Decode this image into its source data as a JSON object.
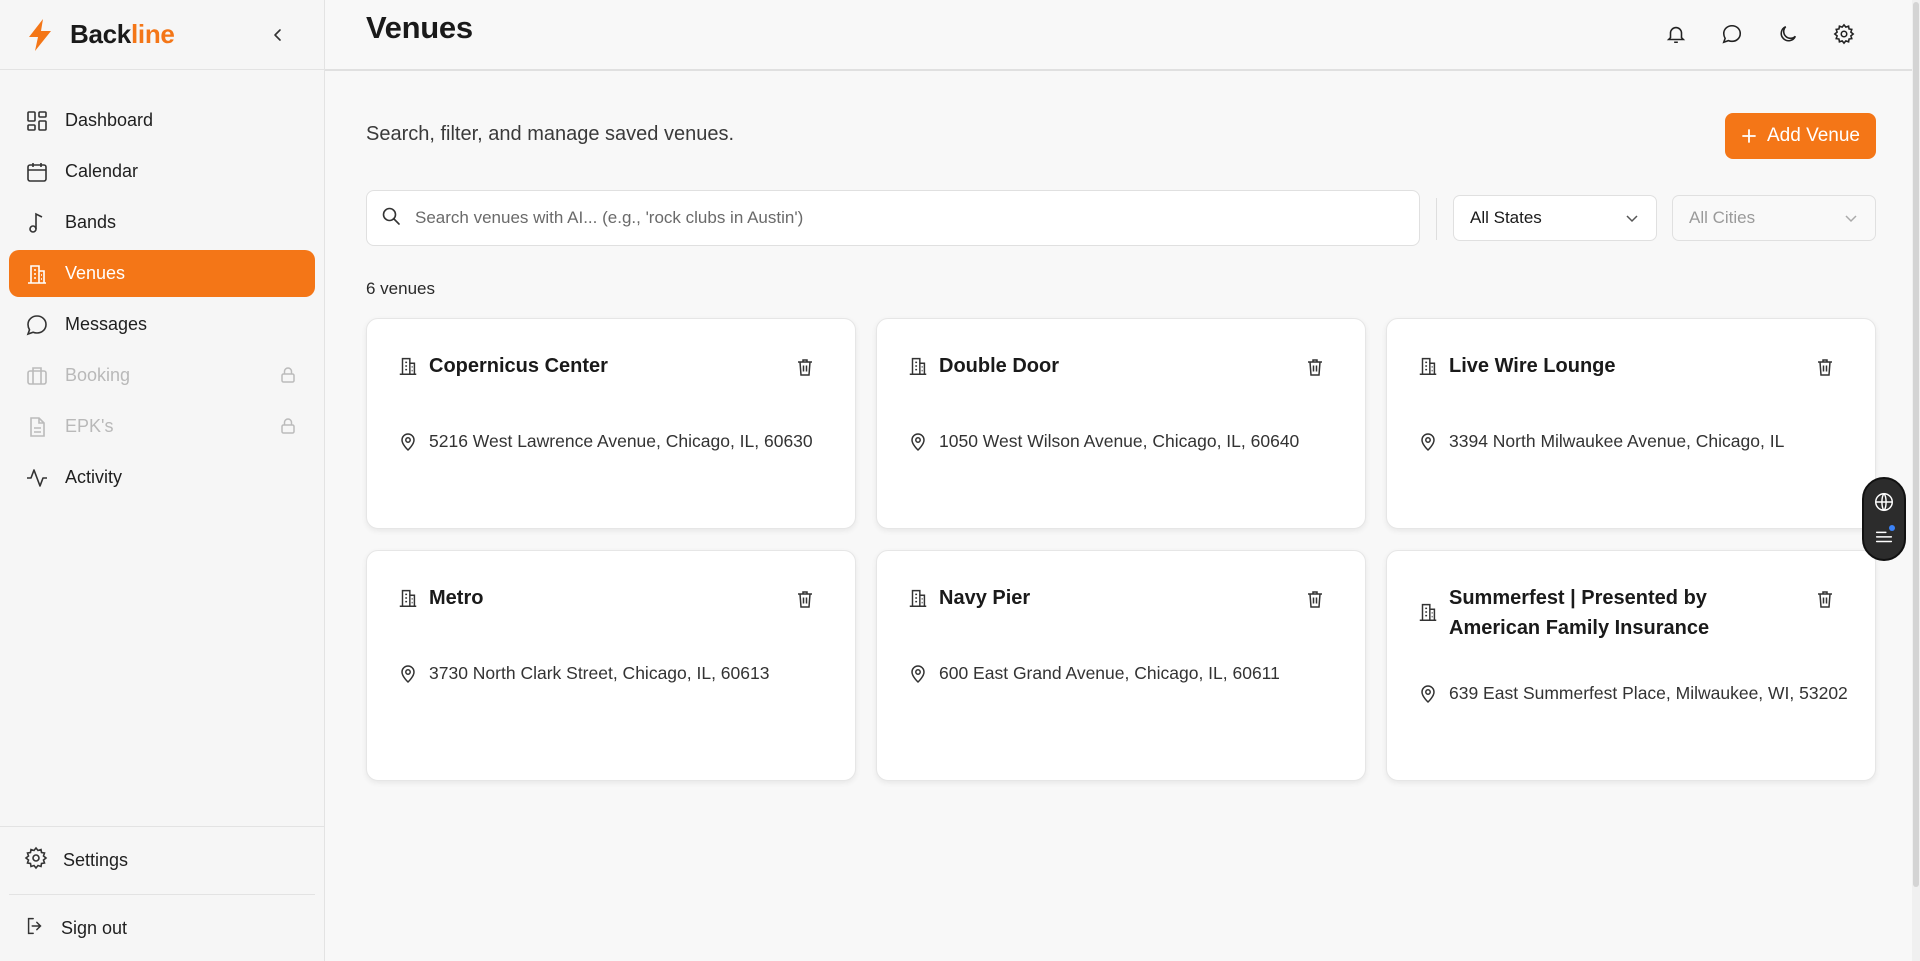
{
  "brand": {
    "name_part1": "Back",
    "name_part2": "line",
    "accent": "#f47617"
  },
  "sidebar": {
    "items": [
      {
        "label": "Dashboard",
        "icon": "dashboard-grid-icon",
        "state": "normal"
      },
      {
        "label": "Calendar",
        "icon": "calendar-icon",
        "state": "normal"
      },
      {
        "label": "Bands",
        "icon": "music-note-icon",
        "state": "normal"
      },
      {
        "label": "Venues",
        "icon": "building-icon",
        "state": "active"
      },
      {
        "label": "Messages",
        "icon": "chat-bubble-icon",
        "state": "normal"
      },
      {
        "label": "Booking",
        "icon": "briefcase-icon",
        "state": "locked"
      },
      {
        "label": "EPK's",
        "icon": "document-icon",
        "state": "locked"
      },
      {
        "label": "Activity",
        "icon": "activity-pulse-icon",
        "state": "normal"
      }
    ],
    "settings_label": "Settings",
    "signout_label": "Sign out"
  },
  "header": {
    "title": "Venues"
  },
  "main": {
    "subtitle": "Search, filter, and manage saved venues.",
    "add_label": "Add Venue",
    "search_placeholder": "Search venues with AI... (e.g., 'rock clubs in Austin')",
    "state_filter": "All States",
    "city_filter": "All Cities",
    "count_text": "6 venues"
  },
  "venues": [
    {
      "name": "Copernicus Center",
      "address": "5216 West Lawrence Avenue, Chicago, IL, 60630"
    },
    {
      "name": "Double Door",
      "address": "1050 West Wilson Avenue, Chicago, IL, 60640"
    },
    {
      "name": "Live Wire Lounge",
      "address": "3394 North Milwaukee Avenue, Chicago, IL"
    },
    {
      "name": "Metro",
      "address": "3730 North Clark Street, Chicago, IL, 60613"
    },
    {
      "name": "Navy Pier",
      "address": "600 East Grand Avenue, Chicago, IL, 60611"
    },
    {
      "name": "Summerfest | Presented by American Family Insurance",
      "address": "639 East Summerfest Place, Milwaukee, WI, 53202"
    }
  ]
}
